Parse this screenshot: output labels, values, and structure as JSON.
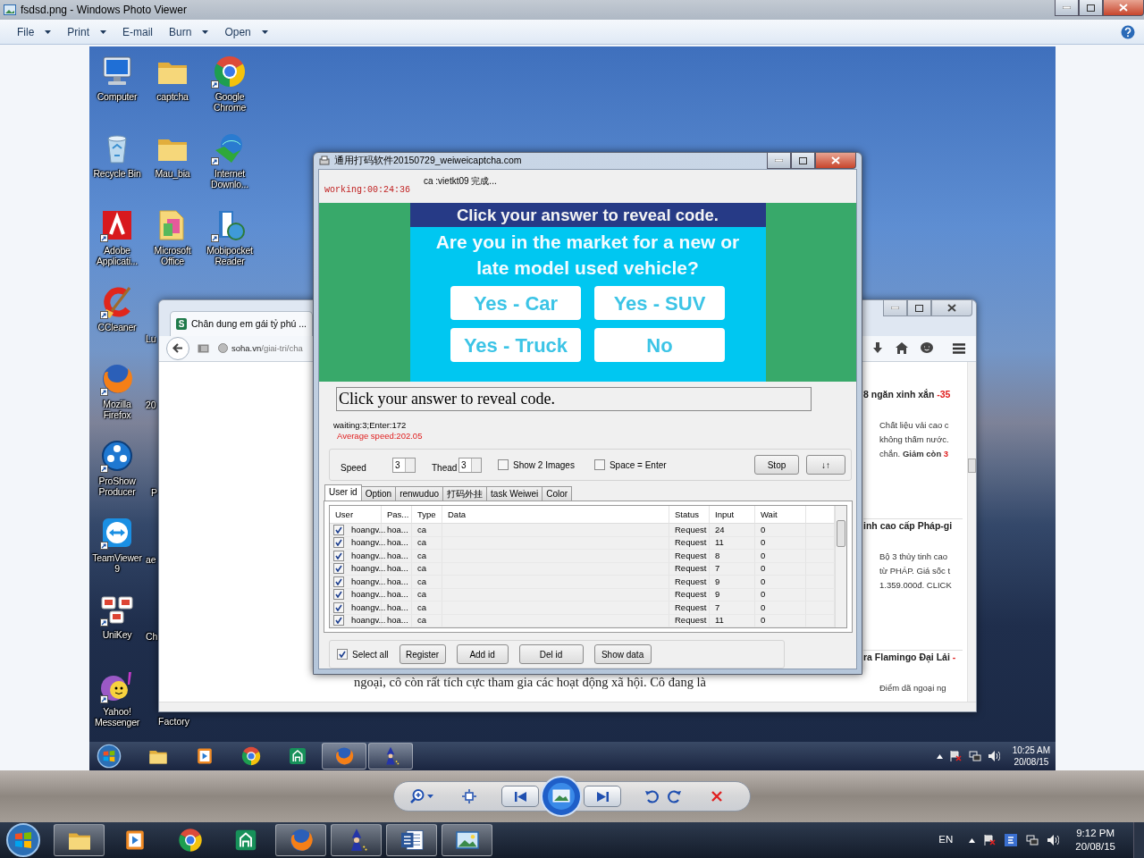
{
  "window": {
    "title": "fsdsd.png - Windows Photo Viewer"
  },
  "menu": [
    {
      "label": "File",
      "has_menu": true
    },
    {
      "label": "Print",
      "has_menu": true
    },
    {
      "label": "E-mail",
      "has_menu": false
    },
    {
      "label": "Burn",
      "has_menu": true
    },
    {
      "label": "Open",
      "has_menu": true
    }
  ],
  "desktop": {
    "icons": [
      {
        "label": "Computer",
        "kind": "computer",
        "shortcut": false
      },
      {
        "label": "captcha",
        "kind": "folder",
        "shortcut": false
      },
      {
        "label": "Google Chrome",
        "kind": "chrome",
        "shortcut": true
      },
      {
        "label": "Recycle Bin",
        "kind": "recycle",
        "shortcut": false
      },
      {
        "label": "Mau_bia",
        "kind": "folder",
        "shortcut": false
      },
      {
        "label": "Internet Downlo...",
        "kind": "download",
        "shortcut": true
      },
      {
        "label": "Adobe Applicati...",
        "kind": "adobe",
        "shortcut": true
      },
      {
        "label": "Microsoft Office",
        "kind": "officefolder",
        "shortcut": false
      },
      {
        "label": "Mobipocket Reader",
        "kind": "mobipocket",
        "shortcut": true
      },
      {
        "label": "CCleaner",
        "kind": "ccleaner",
        "shortcut": true
      },
      {
        "label": "Mozilla Firefox",
        "kind": "firefox",
        "shortcut": true
      },
      {
        "label": "ProShow Producer",
        "kind": "proshow",
        "shortcut": true
      },
      {
        "label": "TeamViewer 9",
        "kind": "teamviewer",
        "shortcut": true
      },
      {
        "label": "UniKey",
        "kind": "unikey",
        "shortcut": true
      },
      {
        "label": "Yahoo! Messenger",
        "kind": "yahoo",
        "shortcut": true
      }
    ],
    "partial_labels": [
      "Lu",
      "20",
      "P",
      "ae",
      "Ch",
      "Factory"
    ],
    "browser": {
      "tab_favicon": "S",
      "tab_title": "Chân dung em gái tỷ phú ...",
      "url_domain": "soha.vn",
      "url_path": "/giai-tri/cha",
      "article_line": "ngoại, cô còn rất tích cực tham gia các hoạt động xã hội. Cô đang là",
      "ads": [
        {
          "title": "8 ngăn xinh xắn",
          "tag": "-35",
          "lines": [
            "Chất liệu vải cao c",
            "không thấm nước.",
            "chắn. **Giảm còn**"
          ],
          "price": "3"
        },
        {
          "title": "inh cao cấp Pháp-gi",
          "lines": [
            "Bộ 3 thủy tinh cao",
            "từ PHÁP. Giá sốc t",
            "1.359.000đ. CLICK"
          ]
        },
        {
          "title": "ra Flamingo Đại Lải",
          "tag": "-",
          "lines": [
            "Điểm dã ngoại ng"
          ]
        }
      ]
    },
    "app": {
      "title": "通用打码软件20150729_weiweicaptcha.com",
      "timer": "working:00:24:36",
      "status": "ca :vietkt09 完成...",
      "captcha": {
        "header": "Click your answer to reveal code.",
        "question": "Are you in the market for a new or late model used vehicle?",
        "answers": [
          "Yes - Car",
          "Yes - SUV",
          "Yes - Truck",
          "No"
        ]
      },
      "answer_field": {
        "value": "Click your answer to reveal code."
      },
      "waiting": "waiting:3;Enter:172",
      "average_speed": "Average speed:202.05",
      "speed": {
        "label": "Speed",
        "value": "3"
      },
      "thread": {
        "label": "Thead",
        "value": "3"
      },
      "options": [
        {
          "label": "Show 2 Images",
          "checked": false
        },
        {
          "label": "Space = Enter",
          "checked": false
        }
      ],
      "buttons": [
        "Stop",
        "↓↑"
      ],
      "tabs": [
        {
          "label": "User id",
          "selected": true
        },
        {
          "label": "Option",
          "selected": false
        },
        {
          "label": "renwuduo",
          "selected": false
        },
        {
          "label": "打码外挂",
          "selected": false
        },
        {
          "label": "task Weiwei",
          "selected": false
        },
        {
          "label": "Color",
          "selected": false
        }
      ],
      "columns": [
        "User",
        "Pas...",
        "Type",
        "Data",
        "Status",
        "Input",
        "Wait"
      ],
      "rows": [
        {
          "checked": true,
          "user": "hoangv...",
          "password": "hoa...",
          "type": "ca",
          "status": "Request",
          "input": "24",
          "wait": "0"
        },
        {
          "checked": true,
          "user": "hoangv...",
          "password": "hoa...",
          "type": "ca",
          "status": "Request",
          "input": "11",
          "wait": "0"
        },
        {
          "checked": true,
          "user": "hoangv...",
          "password": "hoa...",
          "type": "ca",
          "status": "Request",
          "input": "8",
          "wait": "0"
        },
        {
          "checked": true,
          "user": "hoangv...",
          "password": "hoa...",
          "type": "ca",
          "status": "Request",
          "input": "7",
          "wait": "0"
        },
        {
          "checked": true,
          "user": "hoangv...",
          "password": "hoa...",
          "type": "ca",
          "status": "Request",
          "input": "9",
          "wait": "0"
        },
        {
          "checked": true,
          "user": "hoangv...",
          "password": "hoa...",
          "type": "ca",
          "status": "Request",
          "input": "9",
          "wait": "0"
        },
        {
          "checked": true,
          "user": "hoangv...",
          "password": "hoa...",
          "type": "ca",
          "status": "Request",
          "input": "7",
          "wait": "0"
        },
        {
          "checked": true,
          "user": "hoangv...",
          "password": "hoa...",
          "type": "ca",
          "status": "Request",
          "input": "11",
          "wait": "0"
        }
      ],
      "select_all": {
        "label": "Select all",
        "checked": true
      },
      "actions": [
        "Register",
        "Add id",
        "Del id",
        "Show data"
      ]
    },
    "taskbar": {
      "apps": [
        {
          "kind": "explorer",
          "running": false
        },
        {
          "kind": "media",
          "running": false
        },
        {
          "kind": "chrome",
          "running": false
        },
        {
          "kind": "greenapp",
          "running": false
        },
        {
          "kind": "firefox",
          "running": true
        },
        {
          "kind": "wizard",
          "running": true
        }
      ],
      "time": "10:25 AM",
      "date": "20/08/15"
    }
  },
  "taskbar": {
    "apps": [
      {
        "kind": "explorer",
        "running": true
      },
      {
        "kind": "media",
        "running": false
      },
      {
        "kind": "chrome",
        "running": false
      },
      {
        "kind": "greenapp",
        "running": false
      },
      {
        "kind": "firefox",
        "running": true
      },
      {
        "kind": "wizard",
        "running": true
      },
      {
        "kind": "word",
        "running": true
      },
      {
        "kind": "photo",
        "running": true
      }
    ],
    "language": "EN",
    "time": "9:12 PM",
    "date": "20/08/15"
  }
}
